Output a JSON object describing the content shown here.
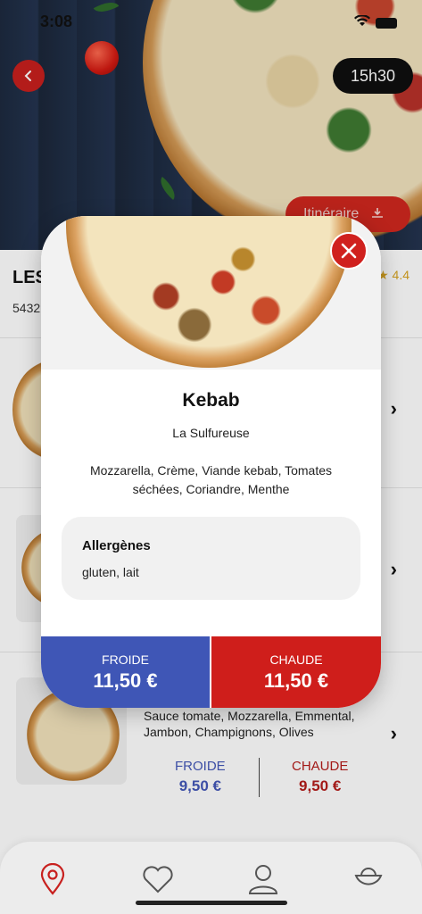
{
  "status_bar": {
    "time": "3:08"
  },
  "header": {
    "back_icon": "chevron-left-icon",
    "time_chip": "15h30",
    "route_label": "Itinéraire",
    "route_icon": "route-icon"
  },
  "restaurant": {
    "title_partial": "LES",
    "address_partial": "5432",
    "rating": "4.4"
  },
  "menu_item_3": {
    "description_line1": "Sauce tomate, Mozzarella, Emmental,",
    "description_line2": "Jambon, Champignons, Olives",
    "cold_label": "FROIDE",
    "cold_price": "9,50 €",
    "hot_label": "CHAUDE",
    "hot_price": "9,50 €"
  },
  "modal": {
    "title": "Kebab",
    "subtitle": "La Sulfureuse",
    "ingredients_line1": "Mozzarella, Crème, Viande kebab, Tomates",
    "ingredients_line2": "séchées, Coriandre, Menthe",
    "allergens_title": "Allergènes",
    "allergens": "gluten, lait",
    "cold_label": "FROIDE",
    "cold_price": "11,50 €",
    "hot_label": "CHAUDE",
    "hot_price": "11,50 €",
    "close_icon": "close-icon"
  },
  "tabbar": {
    "tabs": [
      "location-pin-icon",
      "heart-icon",
      "user-icon",
      "bag-icon"
    ],
    "active_color": "#c8201e"
  },
  "colors": {
    "cold": "#3f56b6",
    "hot": "#cf1e1b",
    "accent": "#c8201e"
  }
}
